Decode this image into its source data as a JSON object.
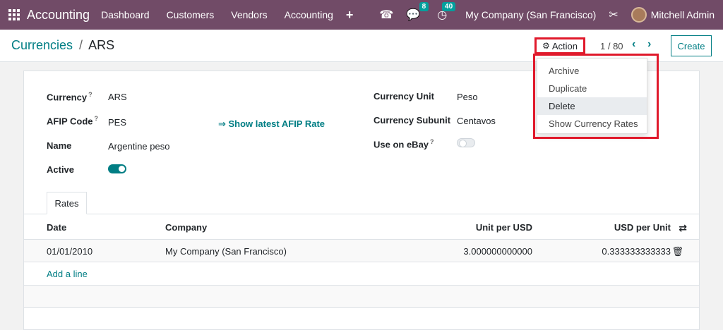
{
  "navbar": {
    "brand": "Accounting",
    "menu": [
      "Dashboard",
      "Customers",
      "Vendors",
      "Accounting"
    ],
    "plus": "+",
    "messages_count": "8",
    "activities_count": "40",
    "company": "My Company (San Francisco)",
    "user": "Mitchell Admin",
    "bg_color": "#714b67"
  },
  "breadcrumb": {
    "parent": "Currencies",
    "separator": "/",
    "current": "ARS"
  },
  "controls": {
    "action_label": "Action",
    "pager": "1 / 80",
    "create_label": "Create"
  },
  "dropdown": {
    "items": [
      "Archive",
      "Duplicate",
      "Delete",
      "Show Currency Rates"
    ],
    "highlighted": "Delete"
  },
  "form": {
    "currency_label": "Currency",
    "currency_value": "ARS",
    "afip_label": "AFIP Code",
    "afip_value": "PES",
    "afip_link": "⇒ Show latest AFIP Rate",
    "name_label": "Name",
    "name_value": "Argentine peso",
    "active_label": "Active",
    "active": true,
    "unit_label": "Currency Unit",
    "unit_value": "Peso",
    "subunit_label": "Currency Subunit",
    "subunit_value": "Centavos",
    "ebay_label": "Use on eBay",
    "ebay": false,
    "help_mark": "?"
  },
  "tabs": [
    "Rates"
  ],
  "rates": {
    "columns": [
      "Date",
      "Company",
      "Unit per USD",
      "USD per Unit"
    ],
    "rows": [
      {
        "date": "01/01/2010",
        "company": "My Company (San Francisco)",
        "unit_per_usd": "3.000000000000",
        "usd_per_unit": "0.333333333333"
      }
    ],
    "add_line": "Add a line"
  },
  "accent_color": "#017e84",
  "highlight_color": "#e0192b"
}
